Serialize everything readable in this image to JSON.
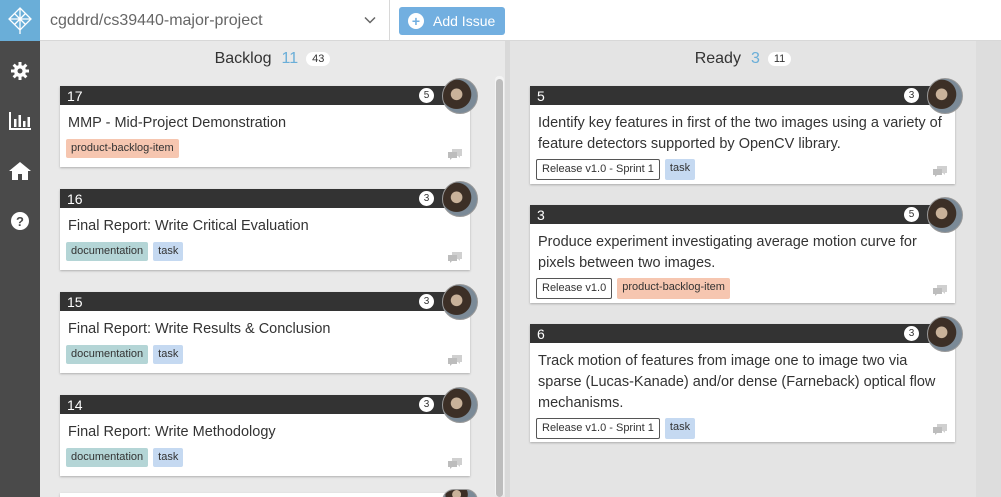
{
  "header": {
    "repo": "cgddrd/cs39440-major-project",
    "add_issue_label": "Add Issue"
  },
  "sidebar": {
    "icons": [
      "gear-icon",
      "chart-icon",
      "home-icon",
      "help-icon"
    ]
  },
  "columns": {
    "backlog": {
      "name": "Backlog",
      "count": "11",
      "total": "43",
      "cards": [
        {
          "number": "17",
          "comments": "5",
          "title": "MMP - Mid-Project Demonstration",
          "labels": [
            "product-backlog-item"
          ]
        },
        {
          "number": "16",
          "comments": "3",
          "title": "Final Report: Write Critical Evaluation",
          "labels": [
            "documentation",
            "task"
          ]
        },
        {
          "number": "15",
          "comments": "3",
          "title": "Final Report: Write Results & Conclusion",
          "labels": [
            "documentation",
            "task"
          ]
        },
        {
          "number": "14",
          "comments": "3",
          "title": "Final Report: Write Methodology",
          "labels": [
            "documentation",
            "task"
          ]
        }
      ]
    },
    "ready": {
      "name": "Ready",
      "count": "3",
      "total": "11",
      "cards": [
        {
          "number": "5",
          "comments": "3",
          "title": "Identify key features in first of the two images using a variety of feature detectors supported by OpenCV library.",
          "labels": [
            "Release v1.0 - Sprint 1",
            "task"
          ]
        },
        {
          "number": "3",
          "comments": "5",
          "title": "Produce experiment investigating average motion curve for pixels between two images.",
          "labels": [
            "Release v1.0",
            "product-backlog-item"
          ]
        },
        {
          "number": "6",
          "comments": "3",
          "title": "Track motion of features from image one to image two via sparse (Lucas-Kanade) and/or dense (Farneback) optical flow mechanisms.",
          "labels": [
            "Release v1.0 - Sprint 1",
            "task"
          ]
        }
      ]
    }
  },
  "colors": {
    "accent": "#6aaed8",
    "sidebar": "#4a4a4a",
    "card_header": "#333333",
    "label_pbi": "#f6c6b0",
    "label_doc": "#b4d5d6",
    "label_task": "#c5d9f1"
  }
}
